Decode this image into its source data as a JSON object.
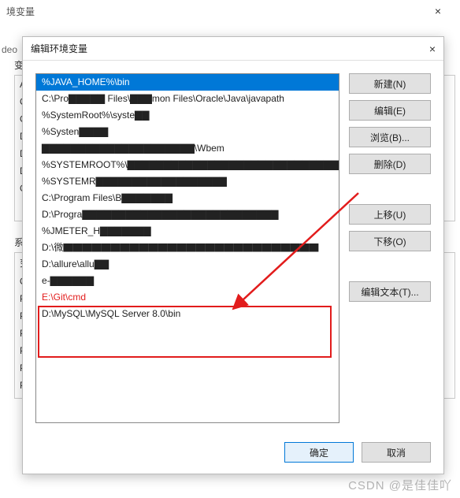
{
  "bg": {
    "title": "境变量",
    "close": "×",
    "left_label": "deo",
    "section1": "变",
    "list1": [
      "AF",
      "CL",
      "CL",
      "Dᴀ",
      "Dᴀ",
      "Dʀ",
      "Gᴀ"
    ],
    "section2": "系统",
    "list2": [
      "变",
      "Oɴ",
      "Pᴀ",
      "Pᴀ",
      "Pʜ",
      "Pʀ",
      "Pʀ",
      "Pʀ"
    ]
  },
  "dialog": {
    "title": "编辑环境变量",
    "close": "×",
    "items": [
      "%JAVA_HOME%\\bin",
      "C:\\Pro▇▇▇▇▇ Files\\▇▇▇mon Files\\Oracle\\Java\\javapath",
      "%SystemRoot%\\syste▇▇",
      "%Systen▇▇▇▇",
      "▇▇▇▇▇▇▇▇▇▇▇▇▇▇▇▇▇▇▇▇▇\\Wbem",
      "%SYSTEMROOT%\\▇▇▇▇▇▇▇▇▇▇▇▇▇▇▇▇▇▇▇▇▇▇▇▇▇▇▇▇▇▇▇.▇▇▇▇",
      "%SYSTEMR▇▇▇▇▇▇▇▇▇▇▇▇▇▇▇▇▇▇",
      "C:\\Program Files\\B▇▇▇▇▇▇▇",
      "D:\\Progra▇▇▇▇▇▇▇▇▇▇▇▇▇▇▇▇▇▇▇▇▇▇▇▇▇▇▇",
      "%JMETER_H▇▇▇▇▇▇▇",
      "D:\\微▇▇▇▇▇▇▇▇▇▇▇▇▇▇▇▇▇▇▇▇▇▇▇▇▇▇▇",
      "D:\\allure\\allu▇▇",
      "e-▇▇▇▇▇▇",
      "E:\\Git\\cmd",
      "D:\\MySQL\\MySQL Server 8.0\\bin"
    ],
    "buttons": {
      "new": "新建(N)",
      "edit": "编辑(E)",
      "browse": "浏览(B)...",
      "delete": "删除(D)",
      "moveup": "上移(U)",
      "movedown": "下移(O)",
      "edittext": "编辑文本(T)..."
    },
    "ok": "确定",
    "cancel": "取消"
  },
  "watermark": "CSDN @是佳佳吖"
}
